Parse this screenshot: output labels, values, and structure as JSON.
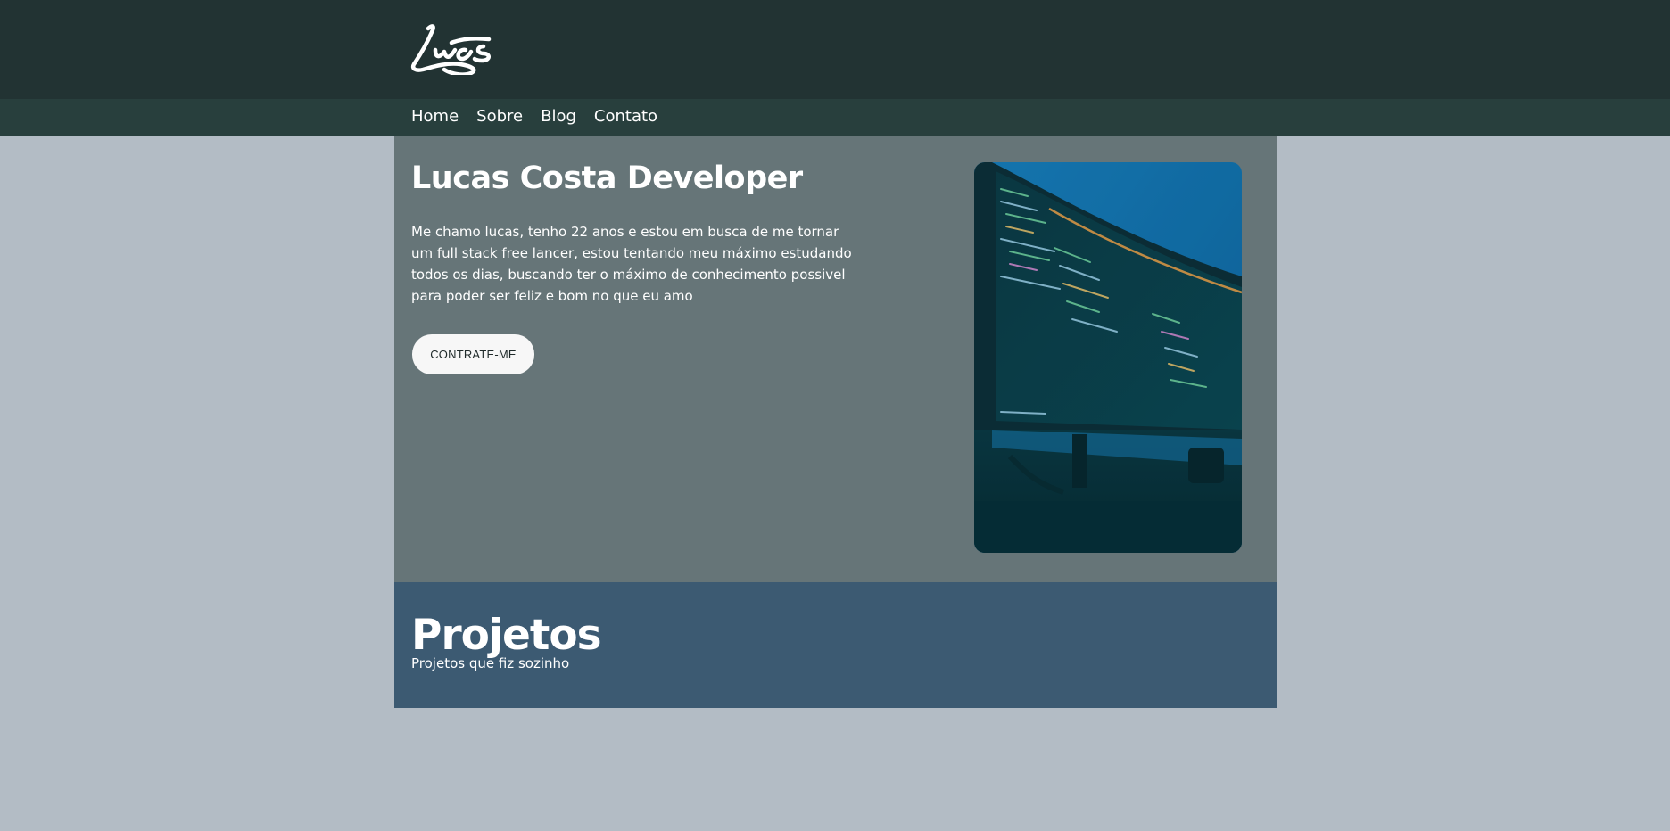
{
  "header": {
    "logo_text": "Lucs"
  },
  "nav": {
    "items": [
      {
        "label": "Home"
      },
      {
        "label": "Sobre"
      },
      {
        "label": "Blog"
      },
      {
        "label": "Contato"
      }
    ]
  },
  "hero": {
    "title": "Lucas Costa Developer",
    "description": "Me chamo lucas, tenho 22 anos e estou em busca de me tornar um full stack free lancer, estou tentando meu máximo estudando todos os dias, buscando ter o máximo de conhecimento possivel para poder ser feliz e bom no que eu amo",
    "button_label": "CONTRATE-ME",
    "image_subject": "curved monitor showing code"
  },
  "projects": {
    "title": "Projetos",
    "subtitle": "Projetos que fiz sozinho"
  },
  "colors": {
    "page_background": "#b3bcc5",
    "topbar": "#223333",
    "navbar": "#283f3d",
    "hero_background": "#667578",
    "projects_background": "#3c5a72",
    "button_background": "#f7f7f7"
  }
}
